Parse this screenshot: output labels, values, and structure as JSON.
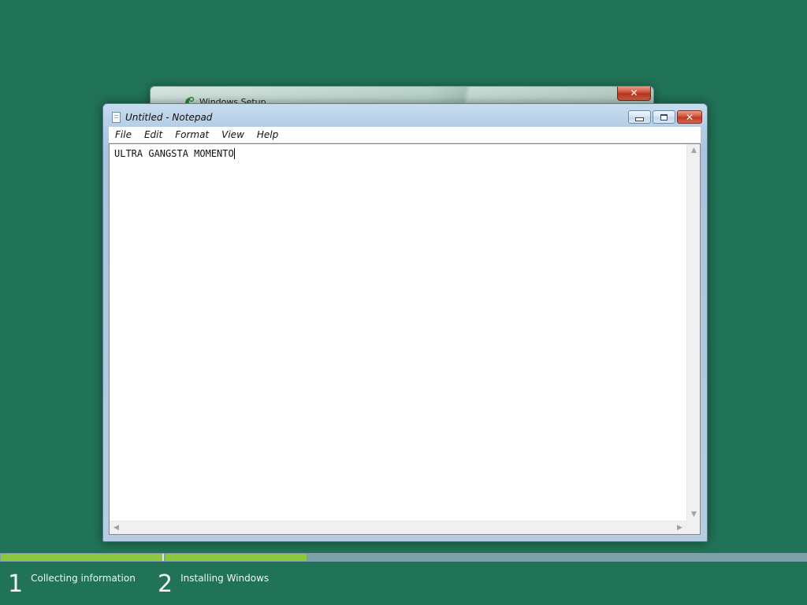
{
  "setup_window": {
    "title": "Windows Setup",
    "close_glyph": "✕",
    "icon": "windows-setup-icon"
  },
  "notepad": {
    "title": "Untitled - Notepad",
    "icon": "notepad-document-icon",
    "controls": {
      "minimize": "minimize-icon",
      "maximize": "maximize-icon",
      "close_glyph": "✕"
    },
    "menu": [
      "File",
      "Edit",
      "Format",
      "View",
      "Help"
    ],
    "content": "ULTRA GANGSTA MOMENTO"
  },
  "progress": {
    "steps": [
      {
        "number": "1",
        "label": "Collecting information",
        "complete_fraction": 1.0
      },
      {
        "number": "2",
        "label": "Installing Windows",
        "complete_fraction": 0.22
      }
    ],
    "colors": {
      "done": "#8dc63f",
      "track": "#7e9fa6"
    }
  },
  "colors": {
    "desktop": "#217357",
    "close_button": "#c7422c"
  }
}
